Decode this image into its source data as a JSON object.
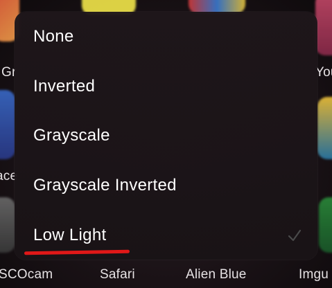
{
  "background": {
    "app_labels": [
      {
        "key": "gr",
        "text": "Gr"
      },
      {
        "key": "you",
        "text": "You"
      },
      {
        "key": "ace",
        "text": "ace"
      },
      {
        "key": "vscocam",
        "text": "SCOcam"
      },
      {
        "key": "safari",
        "text": "Safari"
      },
      {
        "key": "alien_blue",
        "text": "Alien Blue"
      },
      {
        "key": "imgur",
        "text": "Imgu"
      }
    ]
  },
  "menu": {
    "items": [
      {
        "label": "None",
        "selected": false
      },
      {
        "label": "Inverted",
        "selected": false
      },
      {
        "label": "Grayscale",
        "selected": false
      },
      {
        "label": "Grayscale Inverted",
        "selected": false
      },
      {
        "label": "Low Light",
        "selected": true
      }
    ],
    "checkmark_icon": "checkmark-icon"
  },
  "annotation": {
    "underline_color": "#e01818"
  },
  "colors": {
    "menu_background": "#1e161a",
    "text": "#ffffff",
    "checkmark": "#4a4a4a"
  }
}
